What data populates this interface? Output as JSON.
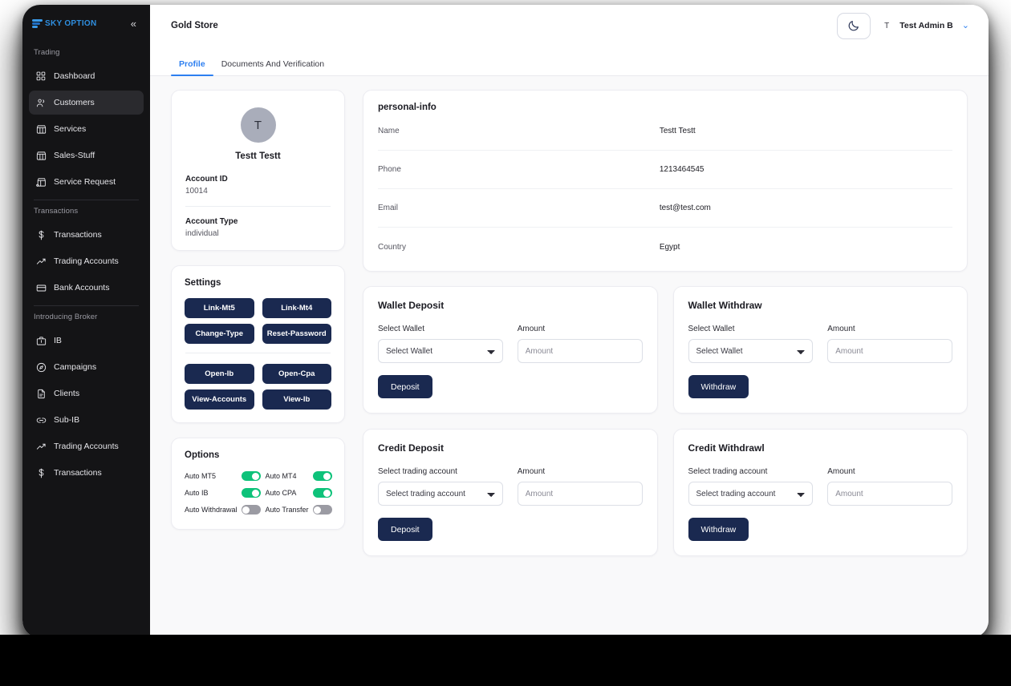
{
  "sidebar": {
    "brand": "SKY OPTION",
    "collapse_icon": "chevrons-left-icon",
    "sections": [
      {
        "label": "Trading",
        "items": [
          {
            "label": "Dashboard",
            "icon": "grid-icon",
            "active": false
          },
          {
            "label": "Customers",
            "icon": "users-icon",
            "active": true
          },
          {
            "label": "Services",
            "icon": "store-icon",
            "active": false
          },
          {
            "label": "Sales-Stuff",
            "icon": "store-icon",
            "active": false
          },
          {
            "label": "Service Request",
            "icon": "store-request-icon",
            "active": false
          }
        ]
      },
      {
        "label": "Transactions",
        "items": [
          {
            "label": "Transactions",
            "icon": "dollar-icon",
            "active": false
          },
          {
            "label": "Trading Accounts",
            "icon": "trend-up-icon",
            "active": false
          },
          {
            "label": "Bank Accounts",
            "icon": "card-icon",
            "active": false
          }
        ]
      },
      {
        "label": "Introducing Broker",
        "items": [
          {
            "label": "IB",
            "icon": "briefcase-icon",
            "active": false
          },
          {
            "label": "Campaigns",
            "icon": "compass-icon",
            "active": false
          },
          {
            "label": "Clients",
            "icon": "document-icon",
            "active": false
          },
          {
            "label": "Sub-IB",
            "icon": "link-icon",
            "active": false
          },
          {
            "label": "Trading Accounts",
            "icon": "trend-up-icon",
            "active": false
          },
          {
            "label": "Transactions",
            "icon": "dollar-icon",
            "active": false
          }
        ]
      }
    ]
  },
  "header": {
    "store_title": "Gold Store",
    "theme_toggle_icon": "moon-icon",
    "avatar_letter": "T",
    "user_name": "Test Admin  B",
    "chevron_icon": "chevron-down-icon"
  },
  "tabs": [
    {
      "label": "Profile",
      "active": true
    },
    {
      "label": "Documents And Verification",
      "active": false
    }
  ],
  "profile_card": {
    "avatar_letter": "T",
    "name": "Testt Testt",
    "account_id_label": "Account ID",
    "account_id_value": "10014",
    "account_type_label": "Account Type",
    "account_type_value": "individual"
  },
  "settings": {
    "title": "Settings",
    "buttons_top": [
      "Link-Mt5",
      "Link-Mt4",
      "Change-Type",
      "Reset-Password"
    ],
    "buttons_bottom": [
      "Open-Ib",
      "Open-Cpa",
      "View-Accounts",
      "View-Ib"
    ]
  },
  "options": {
    "title": "Options",
    "toggles": [
      {
        "label": "Auto MT5",
        "on": true
      },
      {
        "label": "Auto MT4",
        "on": true
      },
      {
        "label": "Auto IB",
        "on": true
      },
      {
        "label": "Auto CPA",
        "on": true
      },
      {
        "label": "Auto Withdrawal",
        "on": false
      },
      {
        "label": "Auto Transfer",
        "on": false
      }
    ]
  },
  "personal_info": {
    "title": "personal-info",
    "rows": [
      {
        "label": "Name",
        "value": "Testt Testt"
      },
      {
        "label": "Phone",
        "value": "1213464545"
      },
      {
        "label": "Email",
        "value": "test@test.com"
      },
      {
        "label": "Country",
        "value": "Egypt"
      }
    ]
  },
  "transaction_cards": [
    {
      "title": "Wallet Deposit",
      "select_label": "Select Wallet",
      "select_value": "Select Wallet",
      "amount_label": "Amount",
      "amount_placeholder": "Amount",
      "action_label": "Deposit"
    },
    {
      "title": "Wallet Withdraw",
      "select_label": "Select Wallet",
      "select_value": "Select Wallet",
      "amount_label": "Amount",
      "amount_placeholder": "Amount",
      "action_label": "Withdraw"
    },
    {
      "title": "Credit Deposit",
      "select_label": "Select trading account",
      "select_value": "Select trading account",
      "amount_label": "Amount",
      "amount_placeholder": "Amount",
      "action_label": "Deposit"
    },
    {
      "title": "Credit Withdrawl",
      "select_label": "Select trading account",
      "select_value": "Select trading account",
      "amount_label": "Amount",
      "amount_placeholder": "Amount",
      "action_label": "Withdraw"
    }
  ],
  "colors": {
    "accent_blue": "#2d7ff0",
    "button_navy": "#1a2950",
    "toggle_on_green": "#0ec27a",
    "toggle_off_gray": "#9b9ba3",
    "sidebar_bg": "#141416",
    "page_bg": "#f9f9fa"
  }
}
